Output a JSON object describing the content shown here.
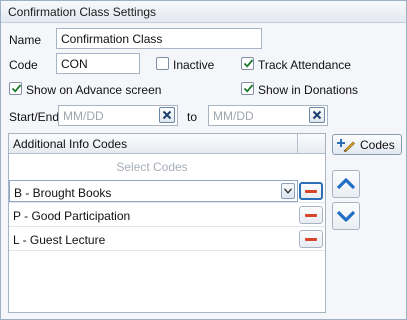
{
  "window": {
    "title": "Confirmation Class Settings"
  },
  "form": {
    "name_label": "Name",
    "name_value": "Confirmation Class",
    "code_label": "Code",
    "code_value": "CON",
    "inactive_label": "Inactive",
    "inactive_checked": false,
    "track_attendance_label": "Track Attendance",
    "track_attendance_checked": true,
    "show_advance_label": "Show on Advance screen",
    "show_advance_checked": true,
    "show_donations_label": "Show in Donations",
    "show_donations_checked": true,
    "start_end_label": "Start/End",
    "start_placeholder": "MM/DD",
    "to_label": "to",
    "end_placeholder": "MM/DD"
  },
  "codes_table": {
    "header": "Additional Info Codes",
    "select_prompt": "Select  Codes",
    "rows": [
      {
        "label": "B - Brought Books",
        "editing": true
      },
      {
        "label": "P - Good Participation",
        "editing": false
      },
      {
        "label": "L - Guest Lecture",
        "editing": false
      }
    ]
  },
  "side": {
    "codes_button_label": "Codes"
  },
  "colors": {
    "accent_blue": "#2d6fb6",
    "remove_red": "#d6452a",
    "check_green": "#1f7a2e"
  }
}
